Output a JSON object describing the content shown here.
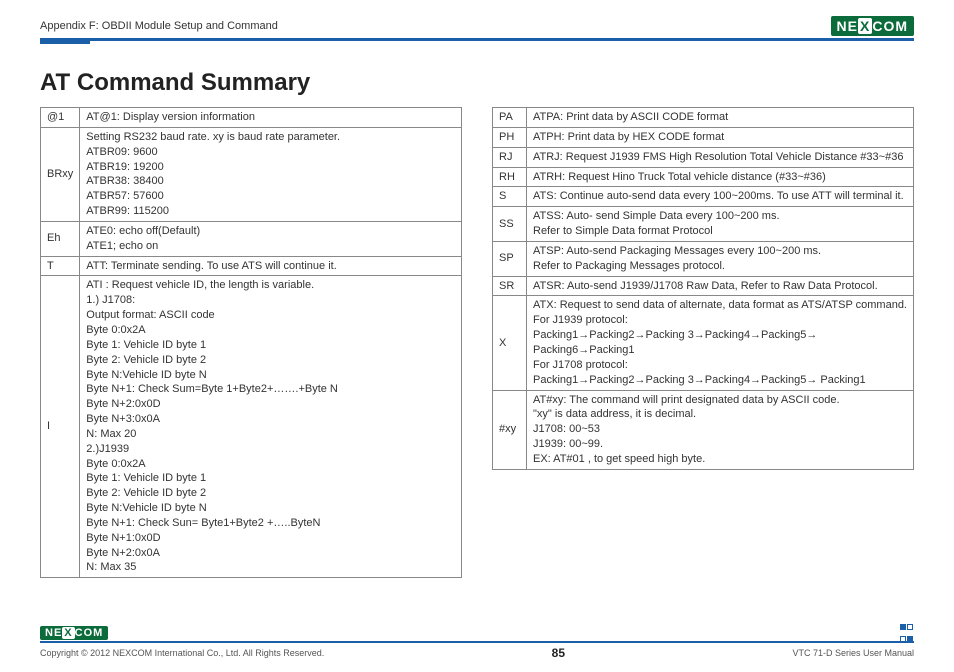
{
  "header": {
    "breadcrumb": "Appendix F: OBDII Module Setup and Command",
    "logo_text": "NE",
    "logo_x": "X",
    "logo_text2": "COM"
  },
  "title": "AT Command Summary",
  "left_rows": [
    {
      "code": "@1",
      "desc": "AT@1: Display version information"
    },
    {
      "code": "BRxy",
      "desc": "Setting RS232 baud rate. xy is baud rate parameter.\nATBR09: 9600\nATBR19: 19200\nATBR38: 38400\nATBR57: 57600\nATBR99: 115200"
    },
    {
      "code": "Eh",
      "desc": "ATE0: echo off(Default)\nATE1; echo on"
    },
    {
      "code": "T",
      "desc": "ATT: Terminate sending. To use ATS will continue it."
    },
    {
      "code": "I",
      "desc": "ATI : Request vehicle ID, the length is variable.\n1.) J1708:\nOutput format: ASCII code\nByte 0:0x2A\nByte 1: Vehicle ID byte 1\nByte 2: Vehicle ID byte 2\nByte N:Vehicle ID byte N\nByte N+1: Check Sum=Byte 1+Byte2+…….+Byte N\nByte N+2:0x0D\nByte N+3:0x0A\nN: Max 20\n2.)J1939\nByte 0:0x2A\nByte 1: Vehicle ID byte 1\nByte 2: Vehicle ID byte 2\nByte N:Vehicle ID byte N\nByte N+1: Check Sun= Byte1+Byte2 +…..ByteN\nByte N+1:0x0D\nByte N+2:0x0A\nN: Max 35"
    }
  ],
  "right_rows": [
    {
      "code": "PA",
      "desc": "ATPA: Print data by ASCII CODE format"
    },
    {
      "code": "PH",
      "desc": "ATPH: Print data by HEX CODE format"
    },
    {
      "code": "RJ",
      "desc": "ATRJ: Request J1939 FMS High Resolution Total Vehicle Distance #33~#36"
    },
    {
      "code": "RH",
      "desc": "ATRH: Request Hino Truck Total vehicle distance (#33~#36)"
    },
    {
      "code": "S",
      "desc": "ATS: Continue auto-send data every 100~200ms. To use ATT will terminal it."
    },
    {
      "code": "SS",
      "desc": "ATSS: Auto- send Simple Data every 100~200 ms.\nRefer to Simple Data format Protocol"
    },
    {
      "code": "SP",
      "desc": "ATSP: Auto-send Packaging Messages every 100~200 ms.\nRefer to Packaging Messages protocol."
    },
    {
      "code": "SR",
      "desc": "ATSR: Auto-send J1939/J1708 Raw Data, Refer to Raw Data Protocol."
    },
    {
      "code": "X",
      "desc": "ATX: Request to send data of alternate, data format as ATS/ATSP command.\nFor J1939 protocol:\nPacking1→Packing2→Packing 3→Packing4→Packing5→ Packing6→Packing1\nFor J1708 protocol:\nPacking1→Packing2→Packing 3→Packing4→Packing5→ Packing1"
    },
    {
      "code": "#xy",
      "desc": "AT#xy: The command will print designated data by ASCII code.\n\"xy\" is data address, it is decimal.\nJ1708: 00~53\nJ1939: 00~99.\nEX: AT#01 , to get speed high byte."
    }
  ],
  "footer": {
    "copyright": "Copyright © 2012 NEXCOM International Co., Ltd. All Rights Reserved.",
    "page": "85",
    "manual": "VTC 71-D Series User Manual"
  }
}
